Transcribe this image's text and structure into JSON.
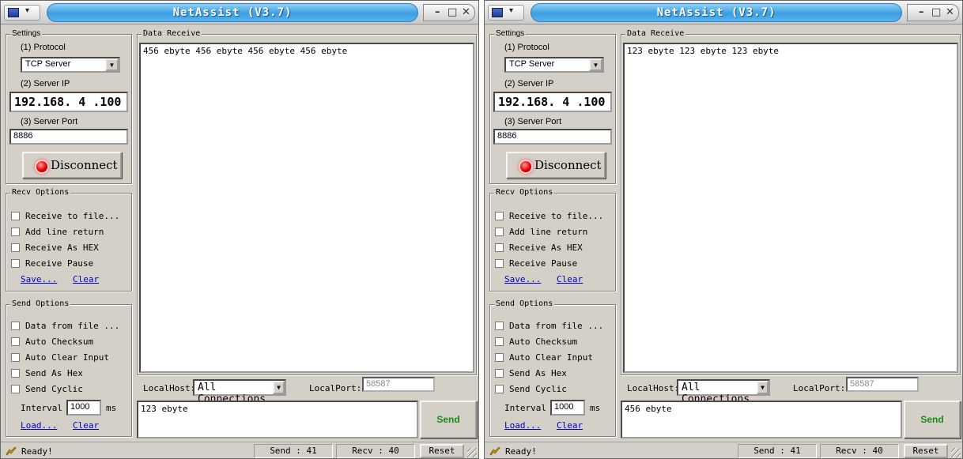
{
  "windows": [
    {
      "title": "NetAssist (V3.7)",
      "settings": {
        "group_label": "Settings",
        "protocol_label": "(1) Protocol",
        "protocol_value": "TCP Server",
        "server_ip_label": "(2) Server IP",
        "server_ip_value": "192.168. 4 .100",
        "server_port_label": "(3) Server Port",
        "server_port_value": "8886",
        "disconnect_label": "Disconnect"
      },
      "recv_options": {
        "group_label": "Recv Options",
        "items": [
          "Receive to file...",
          "Add line return",
          "Receive As HEX",
          "Receive Pause"
        ],
        "save_link": "Save...",
        "clear_link": "Clear"
      },
      "send_options": {
        "group_label": "Send Options",
        "items": [
          "Data from file ...",
          "Auto Checksum",
          "Auto Clear Input",
          "Send As Hex",
          "Send Cyclic"
        ],
        "interval_label": "Interval",
        "interval_value": "1000",
        "interval_unit": "ms",
        "load_link": "Load...",
        "clear_link": "Clear"
      },
      "data_receive": {
        "group_label": "Data Receive",
        "content": "456 ebyte 456 ebyte 456 ebyte 456 ebyte"
      },
      "localhost_label": "LocalHost:",
      "localhost_value": "All Connections",
      "localport_label": "LocalPort:",
      "localport_value": "58587",
      "send_input": "123 ebyte",
      "send_button": "Send",
      "status": {
        "ready": "Ready!",
        "send_count": "Send : 41",
        "recv_count": "Recv : 40",
        "reset": "Reset"
      }
    },
    {
      "title": "NetAssist (V3.7)",
      "settings": {
        "group_label": "Settings",
        "protocol_label": "(1) Protocol",
        "protocol_value": "TCP Server",
        "server_ip_label": "(2) Server IP",
        "server_ip_value": "192.168. 4 .100",
        "server_port_label": "(3) Server Port",
        "server_port_value": "8886",
        "disconnect_label": "Disconnect"
      },
      "recv_options": {
        "group_label": "Recv Options",
        "items": [
          "Receive to file...",
          "Add line return",
          "Receive As HEX",
          "Receive Pause"
        ],
        "save_link": "Save...",
        "clear_link": "Clear"
      },
      "send_options": {
        "group_label": "Send Options",
        "items": [
          "Data from file ...",
          "Auto Checksum",
          "Auto Clear Input",
          "Send As Hex",
          "Send Cyclic"
        ],
        "interval_label": "Interval",
        "interval_value": "1000",
        "interval_unit": "ms",
        "load_link": "Load...",
        "clear_link": "Clear"
      },
      "data_receive": {
        "group_label": "Data Receive",
        "content": "123 ebyte 123 ebyte 123 ebyte"
      },
      "localhost_label": "LocalHost:",
      "localhost_value": "All Connections",
      "localport_label": "LocalPort:",
      "localport_value": "58587",
      "send_input": "456 ebyte",
      "send_button": "Send",
      "status": {
        "ready": "Ready!",
        "send_count": "Send : 41",
        "recv_count": "Recv : 40",
        "reset": "Reset"
      }
    }
  ]
}
